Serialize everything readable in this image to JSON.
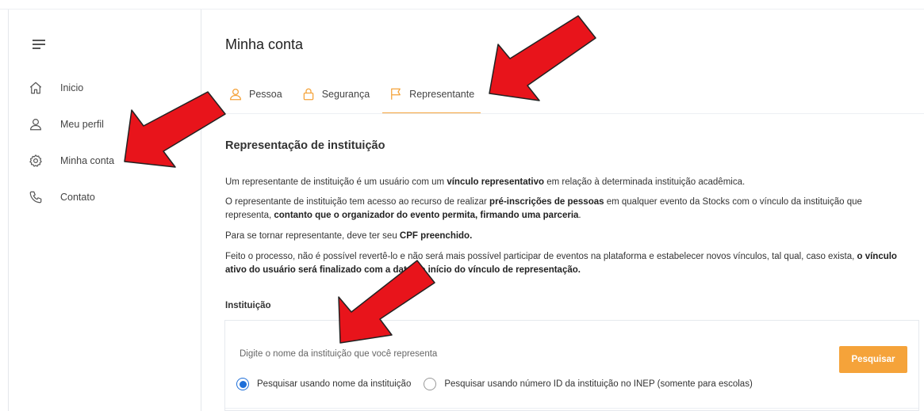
{
  "sidebar": {
    "items": [
      {
        "label": "Inicio",
        "icon": "home-icon"
      },
      {
        "label": "Meu perfil",
        "icon": "user-icon"
      },
      {
        "label": "Minha conta",
        "icon": "gear-icon"
      },
      {
        "label": "Contato",
        "icon": "phone-icon"
      }
    ]
  },
  "main": {
    "title": "Minha conta",
    "tabs": [
      {
        "label": "Pessoa",
        "icon": "user-icon"
      },
      {
        "label": "Segurança",
        "icon": "lock-icon"
      },
      {
        "label": "Representante",
        "icon": "flag-icon",
        "active": true
      }
    ],
    "section_title": "Representação de instituição",
    "paragraphs": {
      "p1_a": "Um representante de instituição é um usuário com um ",
      "p1_b": "vínculo representativo",
      "p1_c": " em relação à determinada instituição acadêmica.",
      "p2_a": "O representante de instituição tem acesso ao recurso de realizar ",
      "p2_b": "pré-inscrições de pessoas",
      "p2_c": " em qualquer evento da Stocks com o vínculo da instituição que representa, ",
      "p2_d": "contanto que o organizador do evento permita, firmando uma parceria",
      "p2_e": ".",
      "p3_a": "Para se tornar representante, deve ter seu ",
      "p3_b": "CPF preenchido.",
      "p4_a": "Feito o processo, não é possível revertê-lo e não será mais possível participar de eventos na plataforma e estabelecer novos vínculos, tal qual, caso exista, ",
      "p4_b": "o vínculo ativo do usuário será finalizado com a data do início do vínculo de representação."
    },
    "institution_label": "Instituição",
    "search": {
      "placeholder": "Digite o nome da instituição que você representa",
      "button": "Pesquisar",
      "radio_options": [
        {
          "label": "Pesquisar usando nome da instituição",
          "checked": true
        },
        {
          "label": "Pesquisar usando número ID da instituição no INEP (somente para escolas)",
          "checked": false
        }
      ]
    }
  },
  "colors": {
    "accent": "#f5a33a",
    "radio": "#1e6fd9",
    "arrow": "#e8141b"
  }
}
